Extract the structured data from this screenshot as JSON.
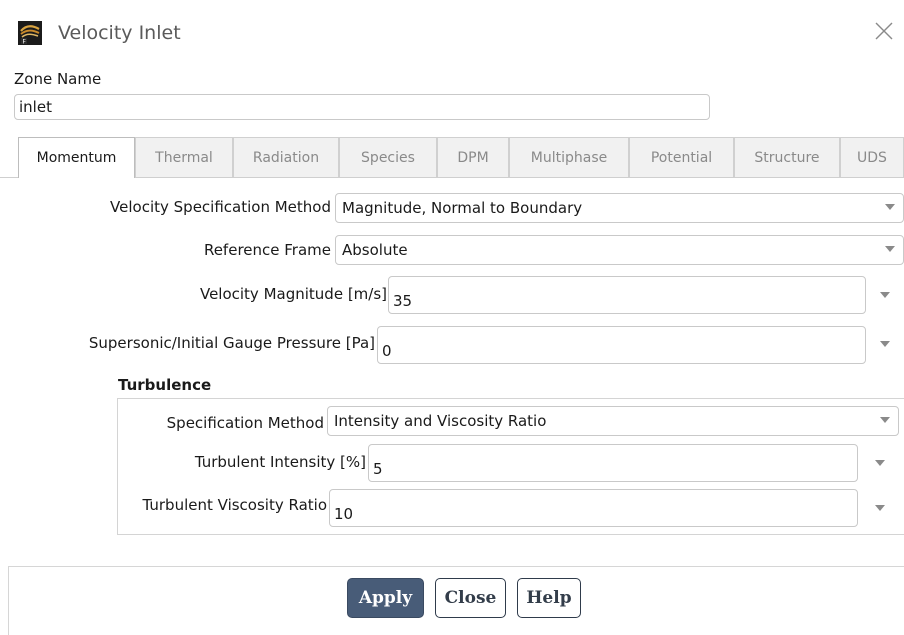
{
  "window": {
    "title": "Velocity Inlet",
    "icon": "ansys-fluent-icon",
    "close_icon": "close-icon"
  },
  "zone": {
    "label": "Zone Name",
    "value": "inlet"
  },
  "tabs": [
    {
      "label": "Momentum",
      "active": true
    },
    {
      "label": "Thermal",
      "active": false
    },
    {
      "label": "Radiation",
      "active": false
    },
    {
      "label": "Species",
      "active": false
    },
    {
      "label": "DPM",
      "active": false
    },
    {
      "label": "Multiphase",
      "active": false
    },
    {
      "label": "Potential",
      "active": false
    },
    {
      "label": "Structure",
      "active": false
    },
    {
      "label": "UDS",
      "active": false
    }
  ],
  "momentum": {
    "velocity_spec": {
      "label": "Velocity Specification Method",
      "value": "Magnitude, Normal to Boundary"
    },
    "reference_frame": {
      "label": "Reference Frame",
      "value": "Absolute"
    },
    "velocity_magnitude": {
      "label": "Velocity Magnitude [m/s]",
      "value": "35"
    },
    "gauge_pressure": {
      "label": "Supersonic/Initial Gauge Pressure [Pa]",
      "value": "0"
    }
  },
  "turbulence": {
    "title": "Turbulence",
    "spec_method": {
      "label": "Specification Method",
      "value": "Intensity and Viscosity Ratio"
    },
    "intensity": {
      "label": "Turbulent Intensity [%]",
      "value": "5"
    },
    "viscosity_ratio": {
      "label": "Turbulent Viscosity Ratio",
      "value": "10"
    }
  },
  "buttons": {
    "apply": "Apply",
    "close": "Close",
    "help": "Help"
  },
  "colors": {
    "apply_bg": "#485c78",
    "button_border": "#2f3b4b",
    "title_text": "#5a5a5a"
  }
}
